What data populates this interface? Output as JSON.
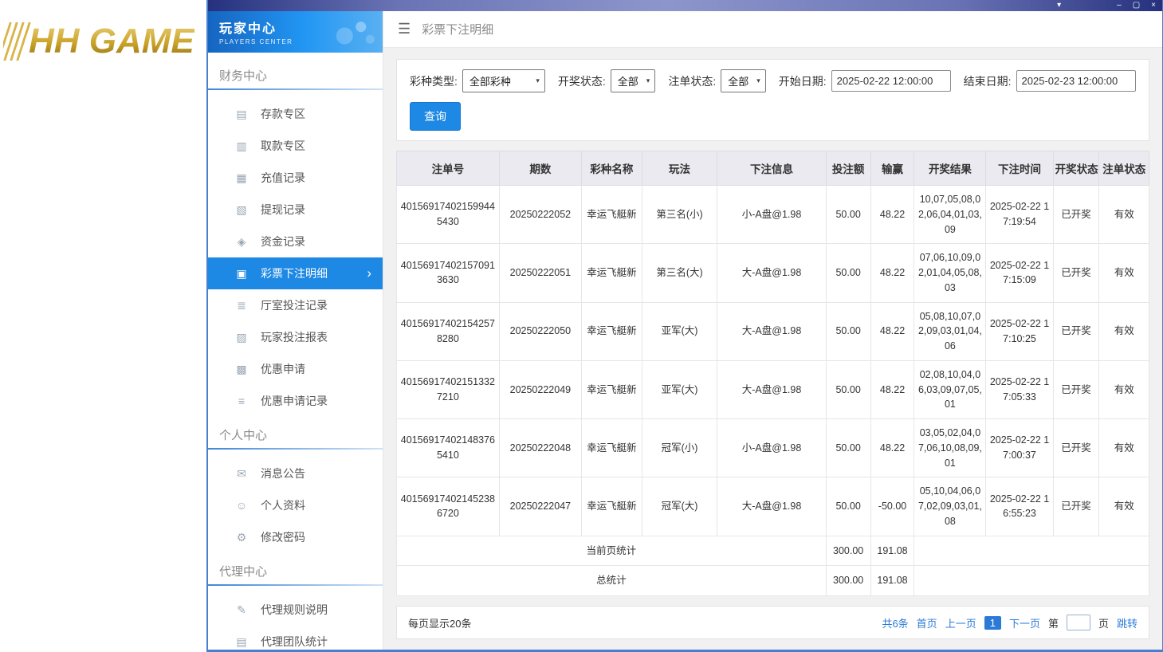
{
  "icons": {
    "hamburger": "☰",
    "chevron_down": "▾",
    "minimize": "–",
    "maximize": "▢",
    "close": "×",
    "chevron_right": "›",
    "select_arrow": "▾",
    "deposit": "▤",
    "withdraw_zone": "▥",
    "recharge_record": "▦",
    "withdraw_record": "▧",
    "funds_record": "◈",
    "lottery_bet_detail": "▣",
    "hall_bet_record": "≣",
    "player_bet_report": "▨",
    "promo_apply": "▩",
    "promo_apply_record": "≡",
    "message": "✉",
    "profile": "☺",
    "password": "⚙",
    "agent_rules": "✎",
    "agent_team": "▤"
  },
  "brand": {
    "logo_text": "HH GAME"
  },
  "sidebar": {
    "header": {
      "title": "玩家中心",
      "subtitle": "PLAYERS CENTER"
    },
    "sections": [
      {
        "title": "财务中心",
        "items": [
          {
            "id": "deposit-zone",
            "label": "存款专区",
            "icon": "deposit"
          },
          {
            "id": "withdraw-zone",
            "label": "取款专区",
            "icon": "withdraw_zone"
          },
          {
            "id": "recharge-records",
            "label": "充值记录",
            "icon": "recharge_record"
          },
          {
            "id": "withdraw-records",
            "label": "提现记录",
            "icon": "withdraw_record"
          },
          {
            "id": "funds-records",
            "label": "资金记录",
            "icon": "funds_record"
          },
          {
            "id": "lottery-bet-details",
            "label": "彩票下注明细",
            "icon": "lottery_bet_detail",
            "active": true
          },
          {
            "id": "hall-bet-records",
            "label": "厅室投注记录",
            "icon": "hall_bet_record"
          },
          {
            "id": "player-bet-report",
            "label": "玩家投注报表",
            "icon": "player_bet_report"
          },
          {
            "id": "promo-apply",
            "label": "优惠申请",
            "icon": "promo_apply"
          },
          {
            "id": "promo-apply-records",
            "label": "优惠申请记录",
            "icon": "promo_apply_record"
          }
        ]
      },
      {
        "title": "个人中心",
        "items": [
          {
            "id": "messages",
            "label": "消息公告",
            "icon": "message"
          },
          {
            "id": "profile",
            "label": "个人资料",
            "icon": "profile"
          },
          {
            "id": "change-password",
            "label": "修改密码",
            "icon": "password"
          }
        ]
      },
      {
        "title": "代理中心",
        "items": [
          {
            "id": "agent-rules",
            "label": "代理规则说明",
            "icon": "agent_rules"
          },
          {
            "id": "agent-team-stats",
            "label": "代理团队统计",
            "icon": "agent_team"
          }
        ]
      }
    ]
  },
  "topbar": {
    "title": "彩票下注明细"
  },
  "filters": {
    "lottery_type": {
      "label": "彩种类型:",
      "value": "全部彩种"
    },
    "draw_status": {
      "label": "开奖状态:",
      "value": "全部"
    },
    "order_status": {
      "label": "注单状态:",
      "value": "全部"
    },
    "start_date": {
      "label": "开始日期:",
      "value": "2025-02-22 12:00:00"
    },
    "end_date": {
      "label": "结束日期:",
      "value": "2025-02-23 12:00:00"
    },
    "query_button": "查询"
  },
  "table": {
    "headers": [
      "注单号",
      "期数",
      "彩种名称",
      "玩法",
      "下注信息",
      "投注额",
      "输赢",
      "开奖结果",
      "下注时间",
      "开奖状态",
      "注单状态"
    ],
    "rows": [
      {
        "order_no": "401569174021599445430",
        "period": "20250222052",
        "lottery": "幸运飞艇新",
        "play": "第三名(小)",
        "bet_info": "小-A盘@1.98",
        "amount": "50.00",
        "winloss": "48.22",
        "result": "10,07,05,08,02,06,04,01,03,09",
        "time": "2025-02-22 17:19:54",
        "draw_status": "已开奖",
        "order_status": "有效"
      },
      {
        "order_no": "401569174021570913630",
        "period": "20250222051",
        "lottery": "幸运飞艇新",
        "play": "第三名(大)",
        "bet_info": "大-A盘@1.98",
        "amount": "50.00",
        "winloss": "48.22",
        "result": "07,06,10,09,02,01,04,05,08,03",
        "time": "2025-02-22 17:15:09",
        "draw_status": "已开奖",
        "order_status": "有效"
      },
      {
        "order_no": "401569174021542578280",
        "period": "20250222050",
        "lottery": "幸运飞艇新",
        "play": "亚军(大)",
        "bet_info": "大-A盘@1.98",
        "amount": "50.00",
        "winloss": "48.22",
        "result": "05,08,10,07,02,09,03,01,04,06",
        "time": "2025-02-22 17:10:25",
        "draw_status": "已开奖",
        "order_status": "有效"
      },
      {
        "order_no": "401569174021513327210",
        "period": "20250222049",
        "lottery": "幸运飞艇新",
        "play": "亚军(大)",
        "bet_info": "大-A盘@1.98",
        "amount": "50.00",
        "winloss": "48.22",
        "result": "02,08,10,04,06,03,09,07,05,01",
        "time": "2025-02-22 17:05:33",
        "draw_status": "已开奖",
        "order_status": "有效"
      },
      {
        "order_no": "401569174021483765410",
        "period": "20250222048",
        "lottery": "幸运飞艇新",
        "play": "冠军(小)",
        "bet_info": "小-A盘@1.98",
        "amount": "50.00",
        "winloss": "48.22",
        "result": "03,05,02,04,07,06,10,08,09,01",
        "time": "2025-02-22 17:00:37",
        "draw_status": "已开奖",
        "order_status": "有效"
      },
      {
        "order_no": "401569174021452386720",
        "period": "20250222047",
        "lottery": "幸运飞艇新",
        "play": "冠军(大)",
        "bet_info": "大-A盘@1.98",
        "amount": "50.00",
        "winloss": "-50.00",
        "result": "05,10,04,06,07,02,09,03,01,08",
        "time": "2025-02-22 16:55:23",
        "draw_status": "已开奖",
        "order_status": "有效"
      }
    ],
    "page_stats": {
      "label": "当前页统计",
      "amount": "300.00",
      "winloss": "191.08"
    },
    "total_stats": {
      "label": "总统计",
      "amount": "300.00",
      "winloss": "191.08"
    }
  },
  "pagination": {
    "page_size_text": "每页显示20条",
    "total_text": "共6条",
    "first": "首页",
    "prev": "上一页",
    "current_page": "1",
    "next": "下一页",
    "jump_prefix": "第",
    "jump_suffix": "页",
    "jump_button": "跳转",
    "jump_value": ""
  },
  "colors": {
    "accent": "#1E88E5",
    "link": "#2b7bd6",
    "gold": "#c9a227"
  }
}
